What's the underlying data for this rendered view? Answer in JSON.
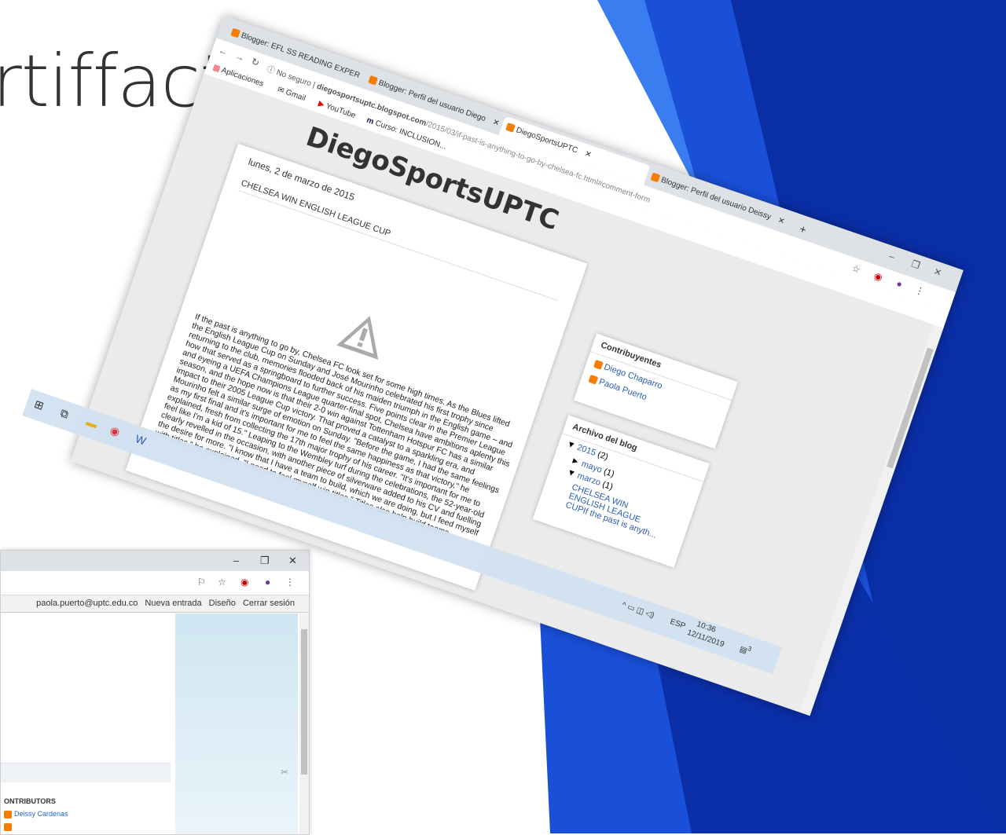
{
  "slide": {
    "title": "rtiffacts"
  },
  "colors": {
    "blue_dark": "#0a2ea6",
    "blue_mid": "#1a4fd8",
    "blue_light": "#3a7df0",
    "blogger_orange": "#f57d00"
  },
  "front_window": {
    "tabs": [
      {
        "label": "Blogger: EFL SS READING EXPER"
      },
      {
        "label": "Blogger: Perfil del usuario Diego"
      },
      {
        "label": "DiegoSportsUPTC"
      },
      {
        "label": "Blogger: Perfil del usuario Deissy"
      }
    ],
    "new_tab": "+",
    "address": {
      "security": "No seguro",
      "domain": "diegosportsuptc.blogspot.com",
      "path": "/2015/03/if-past-is-anything-to-go-by-chelsea-fc.html#comment-form"
    },
    "bookmarks": [
      {
        "label": "Aplicaciones"
      },
      {
        "label": "Gmail"
      },
      {
        "label": "YouTube"
      },
      {
        "label": "Curso: INCLUSION..."
      }
    ],
    "blog": {
      "title": "DiegoSportsUPTC",
      "post_date": "lunes, 2 de marzo de 2015",
      "post_title": "CHELSEA WIN ENGLISH LEAGUE CUP",
      "post_body": "If the past is anything to go by, Chelsea FC look set for some high times. As the Blues lifted the English League Cup on Sunday and José Mourinho celebrated his first trophy since returning to the club, memories flooded back of his maiden triumph in the English game – and how that served as a springboard to further success. Five points clear in the Premier League and eyeing a UEFA Champions League quarter-final spot, Chelsea have ambitions aplenty this season, and the hope now is that their 2-0 win against Tottenham Hotspur FC has a similar impact to their 2005 League Cup victory. That proved a catalyst to a sparkling era, and Mourinho felt a similar surge of emotion on Sunday. \"Before the game, I had the same feelings as my first final and it's important for me to feel the same happiness as that victory,\" he explained, fresh from collecting the 17th major trophy of his career. \"It's important for me to feel like I'm a kid of 15.\" Leaping to the Wembley turf during the celebrations, the 52-year-old clearly revelled in the occasion, with another piece of silverware added to his CV and fuelling the desire for more. \"I know that I have a team to build, which we are doing, but I feed myself with titles,\" he explained. \"I need to feel myself win titles.\" Titles also help build teams.",
      "contributors_title": "Contribuyentes",
      "contributors": [
        "Diego Chaparro",
        "Paola Puerto"
      ],
      "archive_title": "Archivo del blog",
      "archive": {
        "year": "2015",
        "year_count": "(2)",
        "month1": "mayo",
        "month1_count": "(1)",
        "month2": "marzo",
        "month2_count": "(1)",
        "post_link": "CHELSEA WIN ENGLISH LEAGUE CUPIf the past is anyth..."
      }
    }
  },
  "taskbar": {
    "lang": "ESP",
    "time": "10:36",
    "date": "12/11/2019",
    "notif": "3"
  },
  "back_window": {
    "navbar": {
      "email": "paola.puerto@uptc.edu.co",
      "new_post": "Nueva entrada",
      "design": "Diseño",
      "logout": "Cerrar sesión"
    },
    "contributors_title": "ONTRIBUTORS",
    "contributors": [
      "Deissy Cardenas"
    ]
  }
}
